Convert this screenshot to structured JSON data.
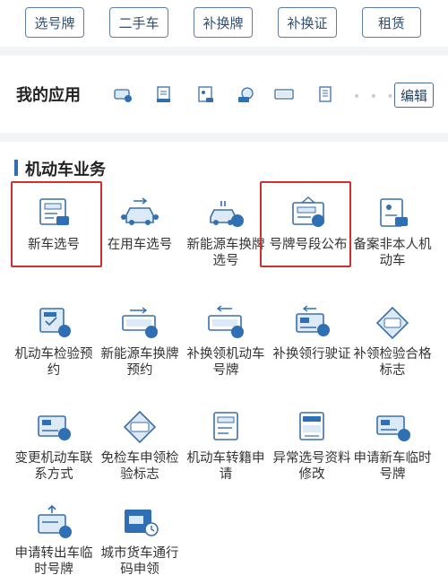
{
  "top_tabs": [
    "选号牌",
    "二手车",
    "补换牌",
    "补换证",
    "租赁"
  ],
  "my_apps": {
    "title": "我的应用",
    "mini_icons": [
      "car-plate-icon",
      "document-icon",
      "id-card-icon",
      "exchange-icon",
      "plate-icon",
      "list-icon"
    ],
    "dots": "• • •",
    "edit_label": "编辑"
  },
  "section": {
    "title": "机动车业务",
    "items": [
      {
        "label": "新车选号",
        "icon": "new-car-plate-icon"
      },
      {
        "label": "在用车选号",
        "icon": "car-in-use-icon"
      },
      {
        "label": "新能源车换牌选号",
        "icon": "new-energy-swap-icon"
      },
      {
        "label": "号牌号段公布",
        "icon": "plate-announce-icon"
      },
      {
        "label": "备案非本人机动车",
        "icon": "register-vehicle-icon"
      },
      {
        "label": "机动车检验预约",
        "icon": "inspection-booking-icon"
      },
      {
        "label": "新能源车换牌预约",
        "icon": "new-energy-booking-icon"
      },
      {
        "label": "补换领机动车号牌",
        "icon": "replace-plate-icon"
      },
      {
        "label": "补换领行驶证",
        "icon": "replace-license-icon"
      },
      {
        "label": "补领检验合格标志",
        "icon": "inspection-mark-icon"
      },
      {
        "label": "变更机动车联系方式",
        "icon": "change-contact-icon"
      },
      {
        "label": "免检车申领检验标志",
        "icon": "exempt-inspection-icon"
      },
      {
        "label": "机动车转籍申请",
        "icon": "transfer-registration-icon"
      },
      {
        "label": "异常选号资料修改",
        "icon": "abnormal-plate-edit-icon"
      },
      {
        "label": "申请新车临时号牌",
        "icon": "temp-plate-new-icon"
      },
      {
        "label": "申请转出车临时号牌",
        "icon": "temp-plate-transfer-icon"
      },
      {
        "label": "城市货车通行码申领",
        "icon": "truck-pass-icon"
      }
    ]
  },
  "colors": {
    "accent": "#2f6fb4",
    "highlight": "#d32f2f",
    "icon_fill": "#dce9f7"
  }
}
